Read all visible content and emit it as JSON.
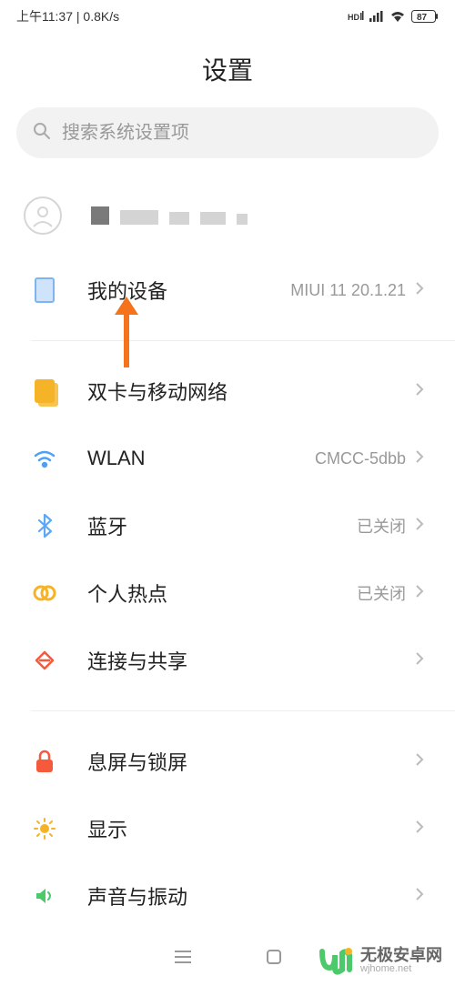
{
  "status_bar": {
    "time_text": "上午11:37 | 0.8K/s",
    "battery": "87"
  },
  "page_title": "设置",
  "search": {
    "placeholder": "搜索系统设置项"
  },
  "groups": [
    {
      "items": [
        {
          "icon": "device",
          "label": "我的设备",
          "value": "MIUI 11 20.1.21"
        }
      ]
    },
    {
      "items": [
        {
          "icon": "sim",
          "label": "双卡与移动网络",
          "value": ""
        },
        {
          "icon": "wifi",
          "label": "WLAN",
          "value": "CMCC-5dbb"
        },
        {
          "icon": "bluetooth",
          "label": "蓝牙",
          "value": "已关闭"
        },
        {
          "icon": "hotspot",
          "label": "个人热点",
          "value": "已关闭"
        },
        {
          "icon": "share",
          "label": "连接与共享",
          "value": ""
        }
      ]
    },
    {
      "items": [
        {
          "icon": "lock",
          "label": "息屏与锁屏",
          "value": ""
        },
        {
          "icon": "sun",
          "label": "显示",
          "value": ""
        },
        {
          "icon": "speaker",
          "label": "声音与振动",
          "value": ""
        }
      ]
    }
  ],
  "watermark": {
    "title": "无极安卓网",
    "url": "wjhome.net"
  }
}
